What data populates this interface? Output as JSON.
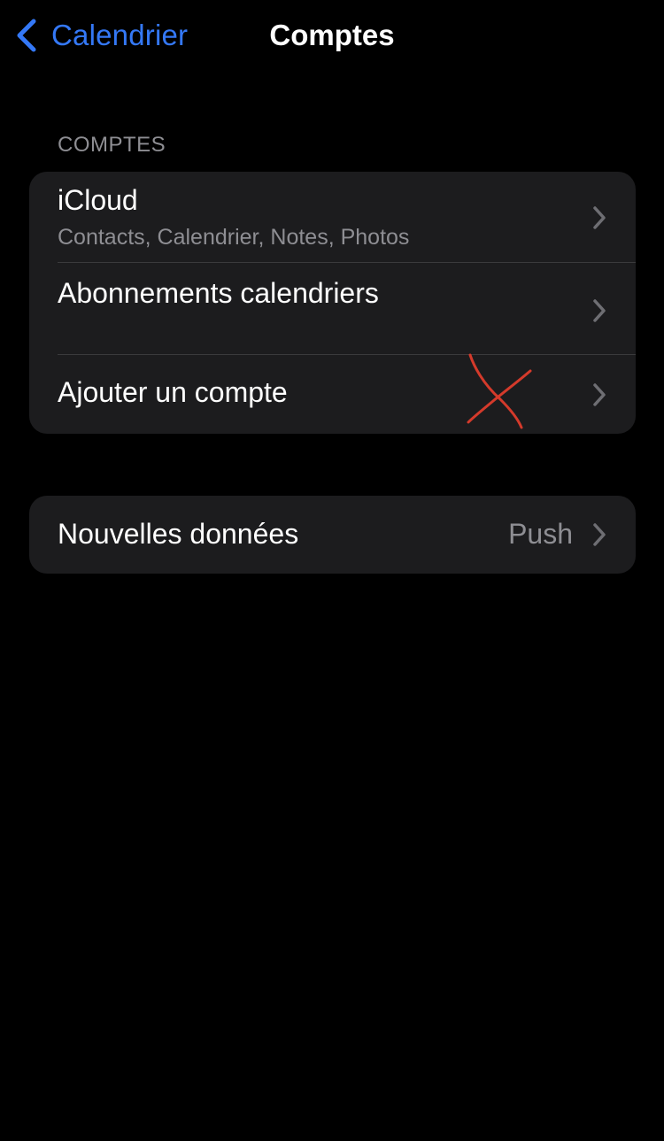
{
  "nav": {
    "back_label": "Calendrier",
    "title": "Comptes"
  },
  "accounts_section": {
    "header": "COMPTES",
    "rows": [
      {
        "title": "iCloud",
        "subtitle": "Contacts, Calendrier, Notes, Photos"
      },
      {
        "title": "Abonnements calendriers"
      },
      {
        "title": "Ajouter un compte"
      }
    ]
  },
  "fetch_section": {
    "title": "Nouvelles données",
    "value": "Push"
  },
  "icons": {
    "back": "chevron-left-icon",
    "disclosure": "chevron-right-icon",
    "annotation": "red-x-mark"
  },
  "colors": {
    "background": "#000000",
    "group_background": "#1c1c1e",
    "accent": "#3478f6",
    "primary_text": "#ffffff",
    "secondary_text": "#8e8e93",
    "separator": "#3a3a3c",
    "chevron": "#6e6e73",
    "annotation": "#d43a2b"
  }
}
